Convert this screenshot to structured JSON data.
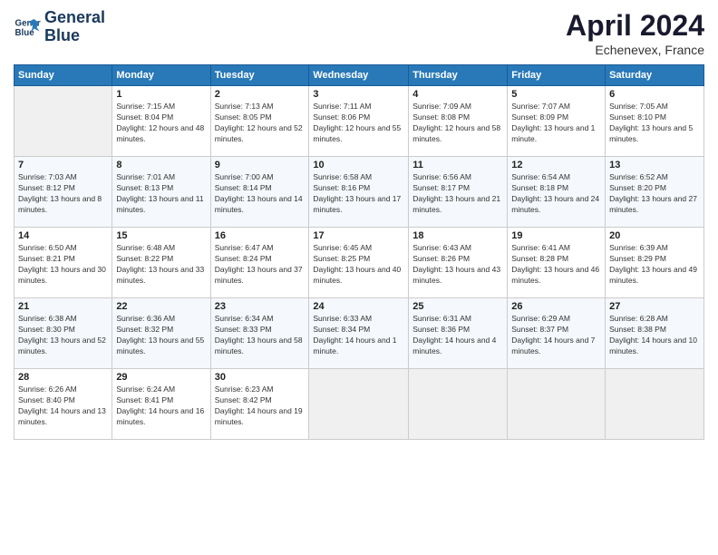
{
  "logo": {
    "line1": "General",
    "line2": "Blue"
  },
  "header": {
    "month": "April 2024",
    "location": "Echenevex, France"
  },
  "days_of_week": [
    "Sunday",
    "Monday",
    "Tuesday",
    "Wednesday",
    "Thursday",
    "Friday",
    "Saturday"
  ],
  "weeks": [
    [
      {
        "day": "",
        "sunrise": "",
        "sunset": "",
        "daylight": ""
      },
      {
        "day": "1",
        "sunrise": "7:15 AM",
        "sunset": "8:04 PM",
        "daylight": "12 hours and 48 minutes."
      },
      {
        "day": "2",
        "sunrise": "7:13 AM",
        "sunset": "8:05 PM",
        "daylight": "12 hours and 52 minutes."
      },
      {
        "day": "3",
        "sunrise": "7:11 AM",
        "sunset": "8:06 PM",
        "daylight": "12 hours and 55 minutes."
      },
      {
        "day": "4",
        "sunrise": "7:09 AM",
        "sunset": "8:08 PM",
        "daylight": "12 hours and 58 minutes."
      },
      {
        "day": "5",
        "sunrise": "7:07 AM",
        "sunset": "8:09 PM",
        "daylight": "13 hours and 1 minute."
      },
      {
        "day": "6",
        "sunrise": "7:05 AM",
        "sunset": "8:10 PM",
        "daylight": "13 hours and 5 minutes."
      }
    ],
    [
      {
        "day": "7",
        "sunrise": "7:03 AM",
        "sunset": "8:12 PM",
        "daylight": "13 hours and 8 minutes."
      },
      {
        "day": "8",
        "sunrise": "7:01 AM",
        "sunset": "8:13 PM",
        "daylight": "13 hours and 11 minutes."
      },
      {
        "day": "9",
        "sunrise": "7:00 AM",
        "sunset": "8:14 PM",
        "daylight": "13 hours and 14 minutes."
      },
      {
        "day": "10",
        "sunrise": "6:58 AM",
        "sunset": "8:16 PM",
        "daylight": "13 hours and 17 minutes."
      },
      {
        "day": "11",
        "sunrise": "6:56 AM",
        "sunset": "8:17 PM",
        "daylight": "13 hours and 21 minutes."
      },
      {
        "day": "12",
        "sunrise": "6:54 AM",
        "sunset": "8:18 PM",
        "daylight": "13 hours and 24 minutes."
      },
      {
        "day": "13",
        "sunrise": "6:52 AM",
        "sunset": "8:20 PM",
        "daylight": "13 hours and 27 minutes."
      }
    ],
    [
      {
        "day": "14",
        "sunrise": "6:50 AM",
        "sunset": "8:21 PM",
        "daylight": "13 hours and 30 minutes."
      },
      {
        "day": "15",
        "sunrise": "6:48 AM",
        "sunset": "8:22 PM",
        "daylight": "13 hours and 33 minutes."
      },
      {
        "day": "16",
        "sunrise": "6:47 AM",
        "sunset": "8:24 PM",
        "daylight": "13 hours and 37 minutes."
      },
      {
        "day": "17",
        "sunrise": "6:45 AM",
        "sunset": "8:25 PM",
        "daylight": "13 hours and 40 minutes."
      },
      {
        "day": "18",
        "sunrise": "6:43 AM",
        "sunset": "8:26 PM",
        "daylight": "13 hours and 43 minutes."
      },
      {
        "day": "19",
        "sunrise": "6:41 AM",
        "sunset": "8:28 PM",
        "daylight": "13 hours and 46 minutes."
      },
      {
        "day": "20",
        "sunrise": "6:39 AM",
        "sunset": "8:29 PM",
        "daylight": "13 hours and 49 minutes."
      }
    ],
    [
      {
        "day": "21",
        "sunrise": "6:38 AM",
        "sunset": "8:30 PM",
        "daylight": "13 hours and 52 minutes."
      },
      {
        "day": "22",
        "sunrise": "6:36 AM",
        "sunset": "8:32 PM",
        "daylight": "13 hours and 55 minutes."
      },
      {
        "day": "23",
        "sunrise": "6:34 AM",
        "sunset": "8:33 PM",
        "daylight": "13 hours and 58 minutes."
      },
      {
        "day": "24",
        "sunrise": "6:33 AM",
        "sunset": "8:34 PM",
        "daylight": "14 hours and 1 minute."
      },
      {
        "day": "25",
        "sunrise": "6:31 AM",
        "sunset": "8:36 PM",
        "daylight": "14 hours and 4 minutes."
      },
      {
        "day": "26",
        "sunrise": "6:29 AM",
        "sunset": "8:37 PM",
        "daylight": "14 hours and 7 minutes."
      },
      {
        "day": "27",
        "sunrise": "6:28 AM",
        "sunset": "8:38 PM",
        "daylight": "14 hours and 10 minutes."
      }
    ],
    [
      {
        "day": "28",
        "sunrise": "6:26 AM",
        "sunset": "8:40 PM",
        "daylight": "14 hours and 13 minutes."
      },
      {
        "day": "29",
        "sunrise": "6:24 AM",
        "sunset": "8:41 PM",
        "daylight": "14 hours and 16 minutes."
      },
      {
        "day": "30",
        "sunrise": "6:23 AM",
        "sunset": "8:42 PM",
        "daylight": "14 hours and 19 minutes."
      },
      {
        "day": "",
        "sunrise": "",
        "sunset": "",
        "daylight": ""
      },
      {
        "day": "",
        "sunrise": "",
        "sunset": "",
        "daylight": ""
      },
      {
        "day": "",
        "sunrise": "",
        "sunset": "",
        "daylight": ""
      },
      {
        "day": "",
        "sunrise": "",
        "sunset": "",
        "daylight": ""
      }
    ]
  ],
  "labels": {
    "sunrise_prefix": "Sunrise: ",
    "sunset_prefix": "Sunset: ",
    "daylight_prefix": "Daylight: "
  }
}
